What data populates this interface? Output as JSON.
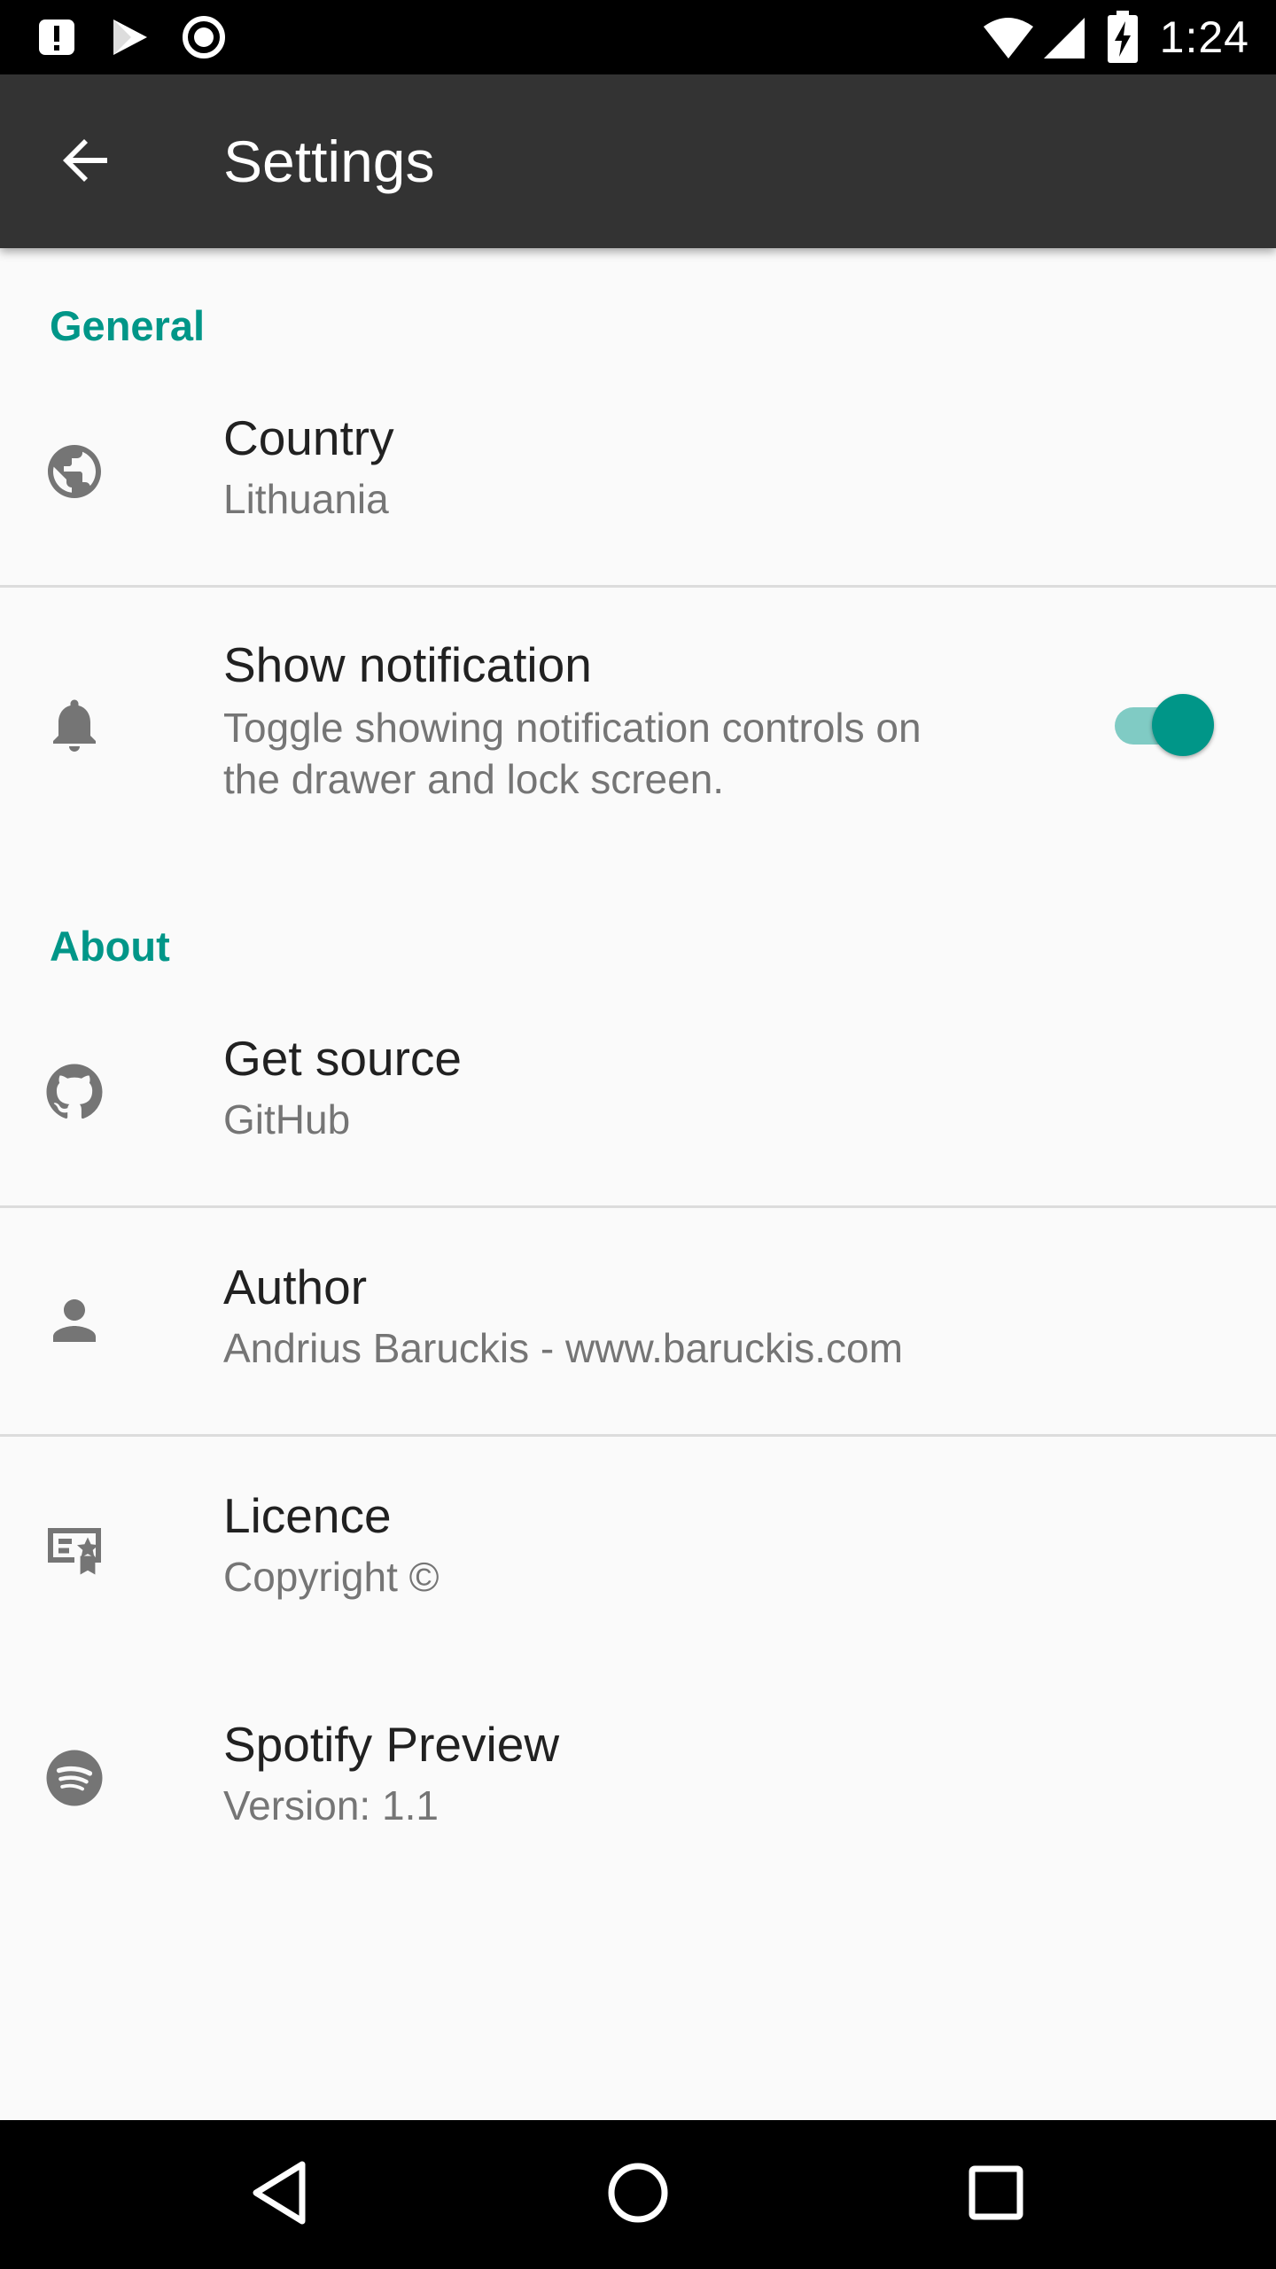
{
  "status_bar": {
    "time": "1:24",
    "icons": [
      "alert-icon",
      "play-store-icon",
      "record-icon",
      "wifi-icon",
      "cell-signal-icon",
      "battery-charging-icon"
    ]
  },
  "app_bar": {
    "title": "Settings",
    "back_icon": "arrow-back-icon"
  },
  "sections": {
    "general": {
      "header": "General",
      "country": {
        "title": "Country",
        "summary": "Lithuania",
        "icon": "globe-icon"
      },
      "notification": {
        "title": "Show notification",
        "summary_line1": "Toggle showing notification controls on",
        "summary_line2": "the drawer and lock screen.",
        "icon": "bell-icon",
        "enabled": true
      }
    },
    "about": {
      "header": "About",
      "source": {
        "title": "Get source",
        "summary": "GitHub",
        "icon": "github-icon"
      },
      "author": {
        "title": "Author",
        "summary": "Andrius Baruckis - www.baruckis.com",
        "icon": "person-icon"
      },
      "licence": {
        "title": "Licence",
        "summary": "Copyright ©",
        "icon": "licence-icon"
      },
      "app": {
        "title": "Spotify Preview",
        "summary": "Version: 1.1",
        "icon": "spotify-icon"
      }
    }
  },
  "nav_bar": {
    "buttons": [
      "back-triangle-icon",
      "home-circle-icon",
      "recents-square-icon"
    ]
  },
  "colors": {
    "accent": "#009688",
    "accent_light": "#80cbc4",
    "app_bar": "#333333",
    "background": "#fafafa"
  }
}
